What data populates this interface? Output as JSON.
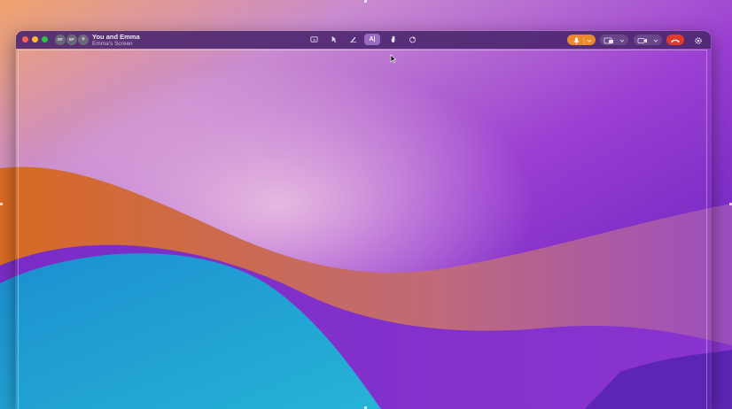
{
  "window": {
    "title": "You and Emma",
    "subtitle": "Emma's Screen"
  },
  "participants": [
    {
      "initials": "EF",
      "label": "Emma avatar"
    },
    {
      "initials": "EF",
      "label": "You avatar"
    }
  ],
  "add_participant_label": "+",
  "toolbar": {
    "tools": [
      {
        "name": "control-icon",
        "label": ""
      },
      {
        "name": "pointer-icon",
        "label": ""
      },
      {
        "name": "draw-icon",
        "label": ""
      },
      {
        "name": "text-tool",
        "label": "A|"
      },
      {
        "name": "wave-icon",
        "label": ""
      },
      {
        "name": "reaction-icon",
        "label": ""
      }
    ]
  },
  "colors": {
    "mic_active": "#e9892c",
    "end_call": "#e03a2c",
    "titlebar": "#4e2870",
    "traffic_close": "#ff5f57",
    "traffic_minimize": "#febc2e",
    "traffic_zoom": "#28c840"
  },
  "icons": {
    "mic": "microphone-icon",
    "screen_share": "screen-share-icon",
    "camera": "camera-icon",
    "end_call": "phone-hangup-icon",
    "settings": "gear-icon"
  }
}
